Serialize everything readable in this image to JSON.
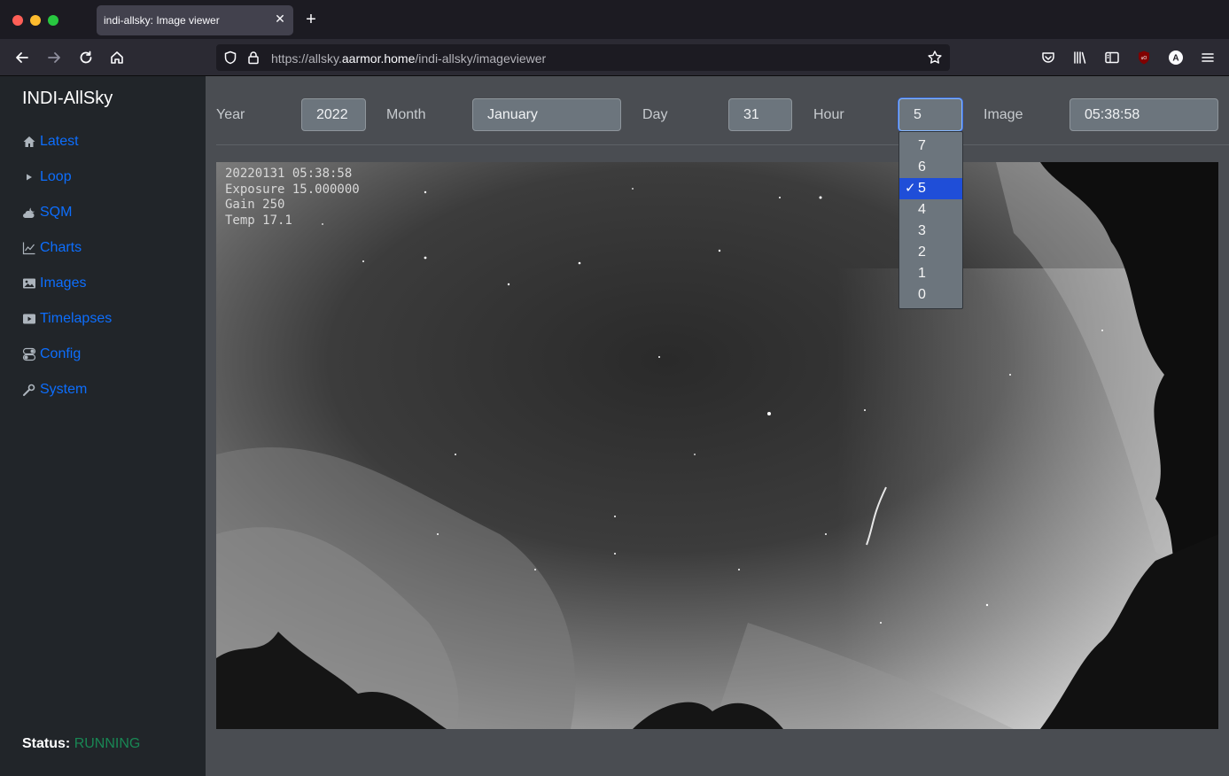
{
  "browser": {
    "tab_title": "indi-allsky: Image viewer",
    "url_prefix": "https://allsky.",
    "url_host": "aarmor.home",
    "url_path": "/indi-allsky/imageviewer"
  },
  "sidebar": {
    "brand": "INDI-AllSky",
    "items": [
      {
        "label": "Latest",
        "icon": "house-icon"
      },
      {
        "label": "Loop",
        "icon": "play-icon"
      },
      {
        "label": "SQM",
        "icon": "cloud-moon-icon"
      },
      {
        "label": "Charts",
        "icon": "chart-line-icon"
      },
      {
        "label": "Images",
        "icon": "image-icon"
      },
      {
        "label": "Timelapses",
        "icon": "video-icon"
      },
      {
        "label": "Config",
        "icon": "toggles-icon"
      },
      {
        "label": "System",
        "icon": "wrench-icon"
      }
    ],
    "status_label": "Status:",
    "status_value": "RUNNING",
    "status_color": "#198754"
  },
  "filters": {
    "year_label": "Year",
    "year_value": "2022",
    "month_label": "Month",
    "month_value": "January",
    "day_label": "Day",
    "day_value": "31",
    "hour_label": "Hour",
    "hour_value": "5",
    "image_label": "Image",
    "image_value": "05:38:58"
  },
  "hour_dropdown": {
    "options": [
      "7",
      "6",
      "5",
      "4",
      "3",
      "2",
      "1",
      "0"
    ],
    "selected": "5",
    "check": "✓"
  },
  "image_overlay": {
    "lines": [
      "20220131 05:38:58",
      "Exposure 15.000000",
      "Gain 250",
      "Temp 17.1"
    ]
  },
  "colors": {
    "link": "#0d6efd",
    "sidebar_bg": "#212529",
    "main_bg": "#4a4d52",
    "select_highlight": "#1f4ed8"
  }
}
